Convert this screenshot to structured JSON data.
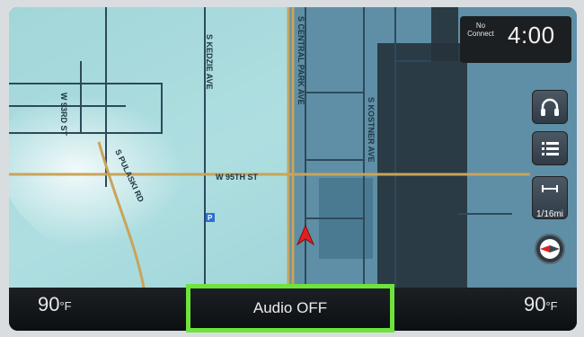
{
  "status": {
    "connection_text": "No Connect",
    "time": "4:00"
  },
  "side_controls": {
    "scale": "1/16mi"
  },
  "map": {
    "streets": [
      "W 93RD ST",
      "S KEDZIE AVE",
      "S CENTRAL PARK AVE",
      "W 95TH ST",
      "S KOSTNER AVE",
      "S PULASKI RD"
    ],
    "colors": {
      "water": "#9fd3d8",
      "land": "#5e8fa6",
      "road": "#c9a45a",
      "vehicle": "#e02020",
      "dark_block": "#26323b"
    }
  },
  "bottom_bar": {
    "temp_left": "90",
    "temp_right": "90",
    "temp_unit": "°F",
    "audio_label": "Audio OFF",
    "highlight_color": "#6ee33b"
  }
}
